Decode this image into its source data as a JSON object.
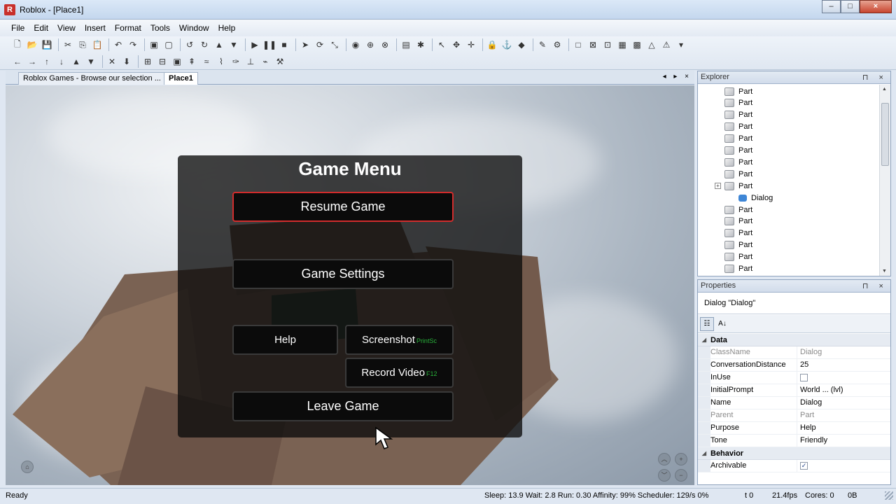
{
  "window": {
    "title": "Roblox - [Place1]",
    "app_icon": "R",
    "controls": {
      "minimize": "–",
      "maximize": "□",
      "close": "×"
    }
  },
  "menu": [
    "File",
    "Edit",
    "View",
    "Insert",
    "Format",
    "Tools",
    "Window",
    "Help"
  ],
  "toolbar1_icons": [
    "new-file-icon",
    "open-folder-icon",
    "save-icon",
    "cut-icon",
    "copy-icon",
    "paste-icon",
    "undo-icon",
    "redo-icon",
    "group-icon",
    "ungroup-icon",
    "rotate-left-icon",
    "rotate-right-icon",
    "move-up-icon",
    "move-down-icon",
    "play-icon",
    "pause-icon",
    "stop-icon",
    "pointer-icon",
    "rotate-icon",
    "scale-icon",
    "camera-icon",
    "zoom-icon",
    "reset-icon",
    "script-icon",
    "lighting-icon",
    "select-tool-icon",
    "move-tool-icon",
    "resize-tool-icon",
    "lock-icon",
    "anchor-icon",
    "paint-icon",
    "material-icon",
    "gear-icon",
    "surface-icon",
    "smooth-icon",
    "glue-icon",
    "weld-icon",
    "studs-icon",
    "inlet-icon",
    "hinge-icon",
    "motor-icon"
  ],
  "toolbar2_icons": [
    "arrow-left-icon",
    "arrow-right-icon",
    "arrow-up-icon",
    "arrow-down-icon",
    "arrow-up-solid-icon",
    "arrow-down-solid-icon",
    "crosshair-icon",
    "drop-icon",
    "terrain-add-icon",
    "terrain-remove-icon",
    "fill-icon",
    "grow-icon",
    "smooth-terrain-icon",
    "erode-icon",
    "paint-terrain-icon",
    "flatten-icon",
    "path-icon",
    "tool-icon"
  ],
  "tabs": [
    {
      "label": "Roblox Games - Browse our selection ..."
    },
    {
      "label": "Place1"
    }
  ],
  "tab_nav": "◂ ▸ ×",
  "game_menu": {
    "title": "Game Menu",
    "resume": "Resume Game",
    "settings": "Game Settings",
    "help": "Help",
    "screenshot": "Screenshot",
    "screenshot_hotkey": "PrintSc",
    "record": "Record Video",
    "record_hotkey": "F12",
    "leave": "Leave Game"
  },
  "explorer": {
    "title": "Explorer",
    "controls": "⊓ ×",
    "items": [
      {
        "label": "Part",
        "icon": "part-icon"
      },
      {
        "label": "Part",
        "icon": "part-icon"
      },
      {
        "label": "Part",
        "icon": "part-icon"
      },
      {
        "label": "Part",
        "icon": "part-icon"
      },
      {
        "label": "Part",
        "icon": "part-icon"
      },
      {
        "label": "Part",
        "icon": "part-icon"
      },
      {
        "label": "Part",
        "icon": "part-icon"
      },
      {
        "label": "Part",
        "icon": "part-icon"
      },
      {
        "label": "Part",
        "icon": "part-icon",
        "expand": "+"
      },
      {
        "label": "Dialog",
        "icon": "dialog-icon",
        "child": true
      },
      {
        "label": "Part",
        "icon": "part-icon"
      },
      {
        "label": "Part",
        "icon": "part-icon"
      },
      {
        "label": "Part",
        "icon": "part-icon"
      },
      {
        "label": "Part",
        "icon": "part-icon"
      },
      {
        "label": "Part",
        "icon": "part-icon"
      },
      {
        "label": "Part",
        "icon": "part-icon"
      }
    ]
  },
  "properties": {
    "title": "Properties",
    "controls": "⊓ ×",
    "selected": "Dialog \"Dialog\"",
    "categories": [
      {
        "name": "Data",
        "rows": [
          {
            "name": "ClassName",
            "value": "Dialog",
            "readonly": true
          },
          {
            "name": "ConversationDistance",
            "value": "25"
          },
          {
            "name": "InUse",
            "value": "",
            "checkbox": true,
            "checked": false
          },
          {
            "name": "InitialPrompt",
            "value": "World ... (lvl)"
          },
          {
            "name": "Name",
            "value": "Dialog"
          },
          {
            "name": "Parent",
            "value": "Part",
            "readonly": true
          },
          {
            "name": "Purpose",
            "value": "Help"
          },
          {
            "name": "Tone",
            "value": "Friendly"
          }
        ]
      },
      {
        "name": "Behavior",
        "rows": [
          {
            "name": "Archivable",
            "value": "",
            "checkbox": true,
            "checked": true
          }
        ]
      }
    ]
  },
  "status": {
    "ready": "Ready",
    "perf": "Sleep: 13.9 Wait: 2.8 Run: 0.30 Affinity: 99% Scheduler: 129/s 0%",
    "t": "t 0",
    "fps": "21.4fps",
    "cores": "Cores: 0",
    "mem": "0B"
  }
}
